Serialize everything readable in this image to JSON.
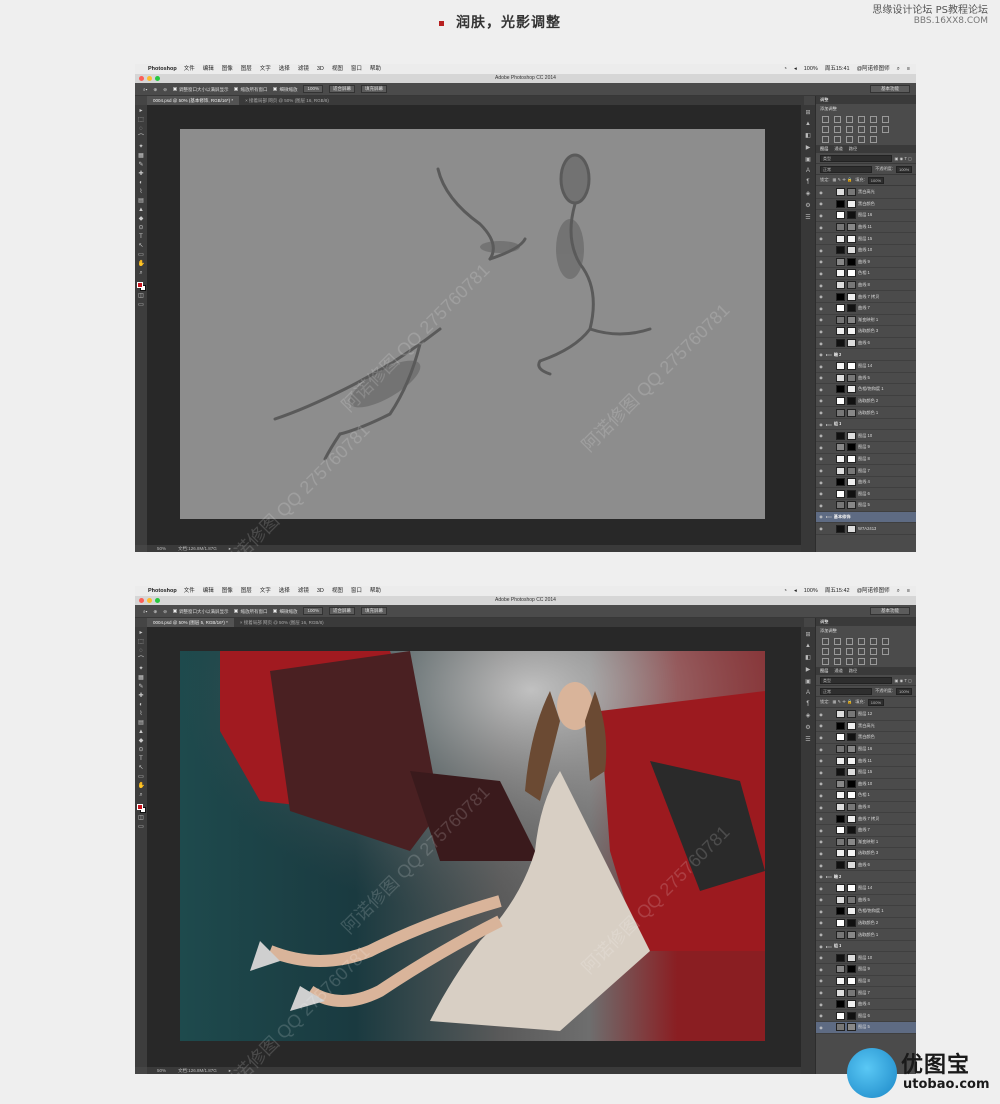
{
  "header": {
    "title": "润肤，光影调整",
    "site_name": "思缘设计论坛",
    "site_sub": "BBS.16XX8.COM",
    "site_badge": "PS教程论坛"
  },
  "colors": {
    "accent": "#b82020",
    "foreground_swatch": "#c8141e"
  },
  "menu": {
    "app": "Photoshop",
    "items": [
      "文件",
      "编辑",
      "图像",
      "图层",
      "文字",
      "选择",
      "滤镜",
      "3D",
      "视图",
      "窗口",
      "帮助"
    ],
    "battery": "100%"
  },
  "window_title": "Adobe Photoshop CC 2014",
  "options": {
    "resize_windows": "调整窗口大小以满屏显示",
    "zoom_all": "缩放所有窗口",
    "scrubby": "细微缩放",
    "zoom_100": "100%",
    "fit_screen": "适合屏幕",
    "fill_screen": "填充屏幕",
    "workspace": "基本功能"
  },
  "screens": [
    {
      "clock": "周五15:41",
      "user": "@阿诺修图师",
      "tabs": [
        "0004.psd @ 50% (基本修饰, RGB/16*) *",
        "× 接着局部 网页 @ 50% (图层 16, RGB/8)"
      ],
      "zoom": "50%",
      "doc_info": "文档:126.8M/1.87G",
      "layers": [
        {
          "name": "黑白高光",
          "type": "normal"
        },
        {
          "name": "黑白颜色",
          "type": "normal"
        },
        {
          "name": "图层 16",
          "type": "normal"
        },
        {
          "name": "曲线 11",
          "type": "normal"
        },
        {
          "name": "图层 15",
          "type": "normal"
        },
        {
          "name": "曲线 10",
          "type": "normal"
        },
        {
          "name": "曲线 9",
          "type": "normal"
        },
        {
          "name": "色相 1",
          "type": "normal"
        },
        {
          "name": "曲线 8",
          "type": "normal"
        },
        {
          "name": "曲线 7 拷贝",
          "type": "normal"
        },
        {
          "name": "曲线 7",
          "type": "normal"
        },
        {
          "name": "渐变映射 1",
          "type": "normal"
        },
        {
          "name": "选取颜色 3",
          "type": "normal"
        },
        {
          "name": "曲线 6",
          "type": "normal"
        },
        {
          "name": "暗 2",
          "type": "group"
        },
        {
          "name": "图层 14",
          "type": "normal"
        },
        {
          "name": "曲线 5",
          "type": "normal"
        },
        {
          "name": "色相/饱和度 1",
          "type": "normal"
        },
        {
          "name": "选取颜色 2",
          "type": "normal"
        },
        {
          "name": "选取颜色 1",
          "type": "normal"
        },
        {
          "name": "组 1",
          "type": "group"
        },
        {
          "name": "图层 10",
          "type": "normal"
        },
        {
          "name": "图层 9",
          "type": "normal"
        },
        {
          "name": "图层 8",
          "type": "normal"
        },
        {
          "name": "图层 7",
          "type": "normal"
        },
        {
          "name": "曲线 4",
          "type": "normal"
        },
        {
          "name": "图层 6",
          "type": "normal"
        },
        {
          "name": "图层 5",
          "type": "normal"
        },
        {
          "name": "基本修饰",
          "type": "group-selected"
        },
        {
          "name": "W7A2413",
          "type": "normal"
        }
      ]
    },
    {
      "clock": "周五15:42",
      "user": "@阿诺修图师",
      "tabs": [
        "0004.psd @ 50% (图层 5, RGB/16*) *",
        "× 接着局部 网页 @ 50% (图层 16, RGB/8)"
      ],
      "zoom": "50%",
      "doc_info": "文档:126.8M/1.87G",
      "layers": [
        {
          "name": "图层 12",
          "type": "normal"
        },
        {
          "name": "黑白高光",
          "type": "normal"
        },
        {
          "name": "黑白颜色",
          "type": "normal"
        },
        {
          "name": "图层 16",
          "type": "normal"
        },
        {
          "name": "曲线 11",
          "type": "normal"
        },
        {
          "name": "图层 15",
          "type": "normal"
        },
        {
          "name": "曲线 10",
          "type": "normal"
        },
        {
          "name": "色相 1",
          "type": "normal"
        },
        {
          "name": "曲线 8",
          "type": "normal"
        },
        {
          "name": "曲线 7 拷贝",
          "type": "normal"
        },
        {
          "name": "曲线 7",
          "type": "normal"
        },
        {
          "name": "渐变映射 1",
          "type": "normal"
        },
        {
          "name": "选取颜色 3",
          "type": "normal"
        },
        {
          "name": "曲线 6",
          "type": "normal"
        },
        {
          "name": "暗 2",
          "type": "group"
        },
        {
          "name": "图层 14",
          "type": "normal"
        },
        {
          "name": "曲线 5",
          "type": "normal"
        },
        {
          "name": "色相/饱和度 1",
          "type": "normal"
        },
        {
          "name": "选取颜色 2",
          "type": "normal"
        },
        {
          "name": "选取颜色 1",
          "type": "normal"
        },
        {
          "name": "组 1",
          "type": "group"
        },
        {
          "name": "图层 10",
          "type": "normal"
        },
        {
          "name": "图层 9",
          "type": "normal"
        },
        {
          "name": "图层 8",
          "type": "normal"
        },
        {
          "name": "图层 7",
          "type": "normal"
        },
        {
          "name": "曲线 4",
          "type": "normal"
        },
        {
          "name": "图层 6",
          "type": "normal"
        },
        {
          "name": "图层 5",
          "type": "selected"
        }
      ]
    }
  ],
  "panels": {
    "tab_adjust": "调整",
    "add_adjust": "添加调整",
    "tab_layers": "图层",
    "tab_channels": "通道",
    "tab_paths": "路径",
    "kind": "类型",
    "blend": "正常",
    "opacity_label": "不透明度:",
    "opacity": "100%",
    "fill_label": "填充:",
    "fill": "100%",
    "lock_label": "锁定:"
  },
  "watermark": "阿诺修图 QQ 275760781",
  "footer_logo": {
    "cn": "优图宝",
    "en": "utobao.com"
  }
}
